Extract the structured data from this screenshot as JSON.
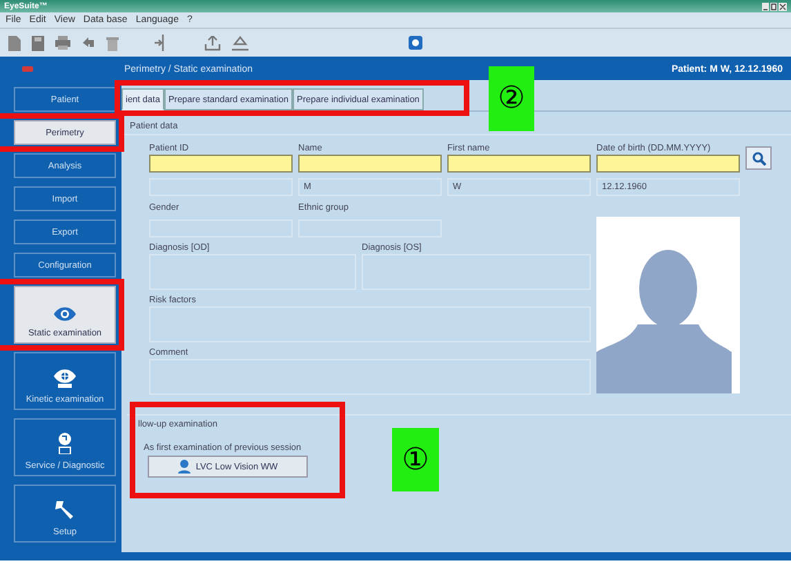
{
  "window": {
    "title": "EyeSuite™"
  },
  "menu": [
    "File",
    "Edit",
    "View",
    "Data base",
    "Language",
    "?"
  ],
  "header": {
    "breadcrumb": "Perimetry / Static examination",
    "patient": "Patient: M W,  12.12.1960"
  },
  "sidebar": {
    "items": [
      {
        "label": "Patient",
        "kind": "small",
        "selected": false
      },
      {
        "label": "Perimetry",
        "kind": "small",
        "selected": true
      },
      {
        "label": "Analysis",
        "kind": "small",
        "selected": false
      },
      {
        "label": "Import",
        "kind": "small",
        "selected": false
      },
      {
        "label": "Export",
        "kind": "small",
        "selected": false
      },
      {
        "label": "Configuration",
        "kind": "small",
        "selected": false
      },
      {
        "label": "Static examination",
        "kind": "eye",
        "selected": true
      },
      {
        "label": "Kinetic examination",
        "kind": "target",
        "selected": false
      },
      {
        "label": "Service / Diagnostic",
        "kind": "service",
        "selected": false
      },
      {
        "label": "Setup",
        "kind": "wrench",
        "selected": false
      }
    ]
  },
  "tabs": [
    {
      "label": "ient data",
      "selected": true
    },
    {
      "label": "Prepare standard examination",
      "selected": false
    },
    {
      "label": "Prepare individual examination",
      "selected": false
    }
  ],
  "patient_data": {
    "title": "Patient data",
    "fields": [
      {
        "label": "Patient ID",
        "highlighted": true
      },
      {
        "label": "Name",
        "highlighted": true,
        "value": "M"
      },
      {
        "label": "First name",
        "highlighted": true,
        "value": "W"
      },
      {
        "label": "Date of birth (DD.MM.YYYY)",
        "highlighted": true,
        "value": "12.12.1960"
      }
    ],
    "gender": {
      "label": "Gender"
    },
    "ethnic_group": {
      "label": "Ethnic group"
    },
    "diagnosis_od": {
      "label": "Diagnosis [OD]"
    },
    "diagnosis_os": {
      "label": "Diagnosis [OS]"
    },
    "risk_factors": {
      "label": "Risk factors"
    },
    "comment": {
      "label": "Comment"
    }
  },
  "follow_up": {
    "title": "llow-up examination",
    "caption": "As first examination of previous session",
    "button": "LVC Low Vision WW"
  },
  "callouts": [
    {
      "label": "①"
    },
    {
      "label": "②"
    }
  ]
}
